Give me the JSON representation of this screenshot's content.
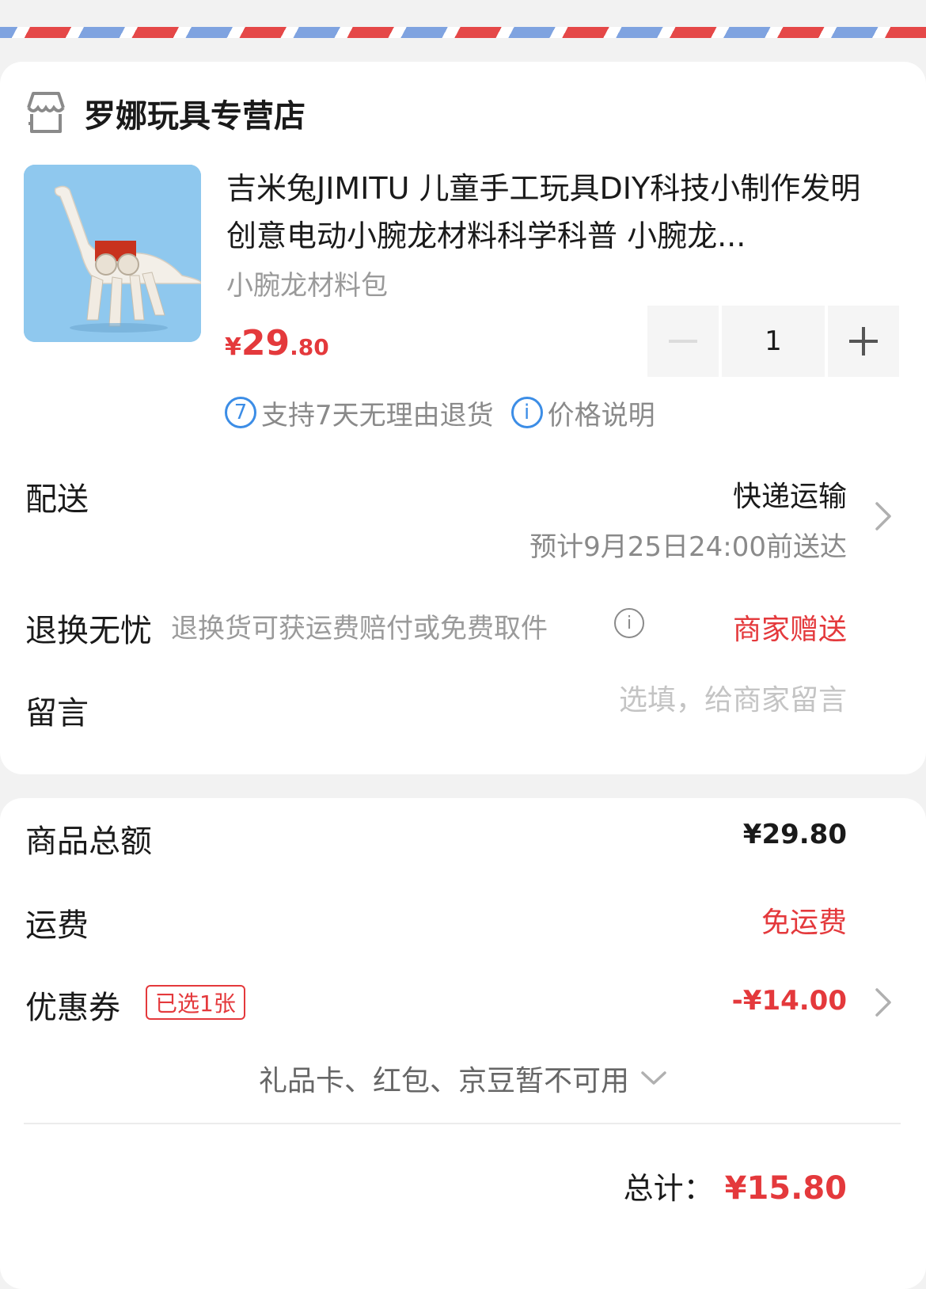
{
  "shop": {
    "name": "罗娜玩具专营店",
    "icon": "store-icon"
  },
  "product": {
    "title": "吉米兔JIMITU 儿童手工玩具DIY科技小制作发明创意电动小腕龙材料科学科普 小腕龙...",
    "variant": "小腕龙材料包",
    "price_symbol": "¥",
    "price_int": "29",
    "price_dec": ".80",
    "quantity": "1",
    "support_badge": "7",
    "support_text": "支持7天无理由退货",
    "price_note_icon": "i",
    "price_note": "价格说明"
  },
  "delivery": {
    "label": "配送",
    "method": "快递运输",
    "eta": "预计9月25日24:00前送达"
  },
  "returns": {
    "label": "退换无忧",
    "desc": "退换货可获运费赔付或免费取件",
    "info_icon": "i",
    "value": "商家赠送"
  },
  "message": {
    "label": "留言",
    "placeholder": "选填，给商家留言"
  },
  "summary": {
    "goods_label": "商品总额",
    "goods_value": "¥29.80",
    "shipping_label": "运费",
    "shipping_value": "免运费",
    "coupon_label": "优惠券",
    "coupon_badge": "已选1张",
    "coupon_value": "-¥14.00",
    "unavailable": "礼品卡、红包、京豆暂不可用",
    "total_label": "总计：",
    "total_value": "¥15.80"
  },
  "colors": {
    "accent": "#e4393c",
    "link_blue": "#3c8de6",
    "image_bg": "#8fc8ee"
  }
}
